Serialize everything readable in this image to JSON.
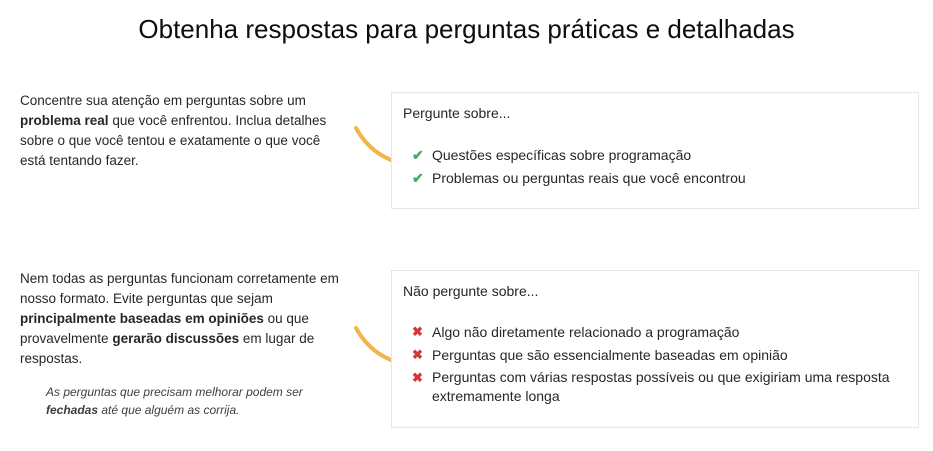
{
  "title": "Obtenha respostas para perguntas práticas e detalhadas",
  "section1": {
    "text_a": "Concentre sua atenção em perguntas sobre um",
    "bold_a": "problema real",
    "text_b": "que você enfrentou. Inclua detalhes sobre o que você tentou e exatamente o que você está tentando fazer.",
    "card_title": "Pergunte sobre...",
    "items": [
      "Questões específicas sobre programação",
      "Problemas ou perguntas reais que você encontrou"
    ]
  },
  "section2": {
    "text_a": "Nem todas as perguntas funcionam corretamente em nosso formato. Evite perguntas que sejam",
    "bold_a": "principalmente baseadas em opiniões",
    "text_b": "ou que provavelmente",
    "bold_b": "gerarão discussões",
    "text_c": "em lugar de respostas.",
    "note_a": "As perguntas que precisam melhorar podem ser",
    "note_bold": "fechadas",
    "note_b": "até que alguém as corrija.",
    "card_title": "Não pergunte sobre...",
    "items": [
      "Algo não diretamente relacionado a programação",
      "Perguntas que são essencialmente baseadas em opinião",
      "Perguntas com várias respostas possíveis ou que exigiriam uma resposta extremamente longa"
    ]
  },
  "icons": {
    "check": "check-icon",
    "cross": "cross-icon",
    "arrow": "curved-arrow-icon"
  },
  "colors": {
    "check": "#48a868",
    "cross": "#d1383d",
    "arrow": "#f2b54b"
  }
}
